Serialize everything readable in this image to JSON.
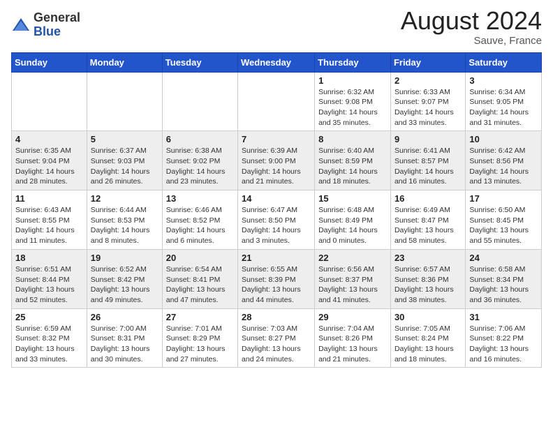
{
  "header": {
    "logo_line1": "General",
    "logo_line2": "Blue",
    "month": "August 2024",
    "location": "Sauve, France"
  },
  "days_of_week": [
    "Sunday",
    "Monday",
    "Tuesday",
    "Wednesday",
    "Thursday",
    "Friday",
    "Saturday"
  ],
  "weeks": [
    [
      {
        "num": "",
        "info": ""
      },
      {
        "num": "",
        "info": ""
      },
      {
        "num": "",
        "info": ""
      },
      {
        "num": "",
        "info": ""
      },
      {
        "num": "1",
        "info": "Sunrise: 6:32 AM\nSunset: 9:08 PM\nDaylight: 14 hours and 35 minutes."
      },
      {
        "num": "2",
        "info": "Sunrise: 6:33 AM\nSunset: 9:07 PM\nDaylight: 14 hours and 33 minutes."
      },
      {
        "num": "3",
        "info": "Sunrise: 6:34 AM\nSunset: 9:05 PM\nDaylight: 14 hours and 31 minutes."
      }
    ],
    [
      {
        "num": "4",
        "info": "Sunrise: 6:35 AM\nSunset: 9:04 PM\nDaylight: 14 hours and 28 minutes."
      },
      {
        "num": "5",
        "info": "Sunrise: 6:37 AM\nSunset: 9:03 PM\nDaylight: 14 hours and 26 minutes."
      },
      {
        "num": "6",
        "info": "Sunrise: 6:38 AM\nSunset: 9:02 PM\nDaylight: 14 hours and 23 minutes."
      },
      {
        "num": "7",
        "info": "Sunrise: 6:39 AM\nSunset: 9:00 PM\nDaylight: 14 hours and 21 minutes."
      },
      {
        "num": "8",
        "info": "Sunrise: 6:40 AM\nSunset: 8:59 PM\nDaylight: 14 hours and 18 minutes."
      },
      {
        "num": "9",
        "info": "Sunrise: 6:41 AM\nSunset: 8:57 PM\nDaylight: 14 hours and 16 minutes."
      },
      {
        "num": "10",
        "info": "Sunrise: 6:42 AM\nSunset: 8:56 PM\nDaylight: 14 hours and 13 minutes."
      }
    ],
    [
      {
        "num": "11",
        "info": "Sunrise: 6:43 AM\nSunset: 8:55 PM\nDaylight: 14 hours and 11 minutes."
      },
      {
        "num": "12",
        "info": "Sunrise: 6:44 AM\nSunset: 8:53 PM\nDaylight: 14 hours and 8 minutes."
      },
      {
        "num": "13",
        "info": "Sunrise: 6:46 AM\nSunset: 8:52 PM\nDaylight: 14 hours and 6 minutes."
      },
      {
        "num": "14",
        "info": "Sunrise: 6:47 AM\nSunset: 8:50 PM\nDaylight: 14 hours and 3 minutes."
      },
      {
        "num": "15",
        "info": "Sunrise: 6:48 AM\nSunset: 8:49 PM\nDaylight: 14 hours and 0 minutes."
      },
      {
        "num": "16",
        "info": "Sunrise: 6:49 AM\nSunset: 8:47 PM\nDaylight: 13 hours and 58 minutes."
      },
      {
        "num": "17",
        "info": "Sunrise: 6:50 AM\nSunset: 8:45 PM\nDaylight: 13 hours and 55 minutes."
      }
    ],
    [
      {
        "num": "18",
        "info": "Sunrise: 6:51 AM\nSunset: 8:44 PM\nDaylight: 13 hours and 52 minutes."
      },
      {
        "num": "19",
        "info": "Sunrise: 6:52 AM\nSunset: 8:42 PM\nDaylight: 13 hours and 49 minutes."
      },
      {
        "num": "20",
        "info": "Sunrise: 6:54 AM\nSunset: 8:41 PM\nDaylight: 13 hours and 47 minutes."
      },
      {
        "num": "21",
        "info": "Sunrise: 6:55 AM\nSunset: 8:39 PM\nDaylight: 13 hours and 44 minutes."
      },
      {
        "num": "22",
        "info": "Sunrise: 6:56 AM\nSunset: 8:37 PM\nDaylight: 13 hours and 41 minutes."
      },
      {
        "num": "23",
        "info": "Sunrise: 6:57 AM\nSunset: 8:36 PM\nDaylight: 13 hours and 38 minutes."
      },
      {
        "num": "24",
        "info": "Sunrise: 6:58 AM\nSunset: 8:34 PM\nDaylight: 13 hours and 36 minutes."
      }
    ],
    [
      {
        "num": "25",
        "info": "Sunrise: 6:59 AM\nSunset: 8:32 PM\nDaylight: 13 hours and 33 minutes."
      },
      {
        "num": "26",
        "info": "Sunrise: 7:00 AM\nSunset: 8:31 PM\nDaylight: 13 hours and 30 minutes."
      },
      {
        "num": "27",
        "info": "Sunrise: 7:01 AM\nSunset: 8:29 PM\nDaylight: 13 hours and 27 minutes."
      },
      {
        "num": "28",
        "info": "Sunrise: 7:03 AM\nSunset: 8:27 PM\nDaylight: 13 hours and 24 minutes."
      },
      {
        "num": "29",
        "info": "Sunrise: 7:04 AM\nSunset: 8:26 PM\nDaylight: 13 hours and 21 minutes."
      },
      {
        "num": "30",
        "info": "Sunrise: 7:05 AM\nSunset: 8:24 PM\nDaylight: 13 hours and 18 minutes."
      },
      {
        "num": "31",
        "info": "Sunrise: 7:06 AM\nSunset: 8:22 PM\nDaylight: 13 hours and 16 minutes."
      }
    ]
  ]
}
